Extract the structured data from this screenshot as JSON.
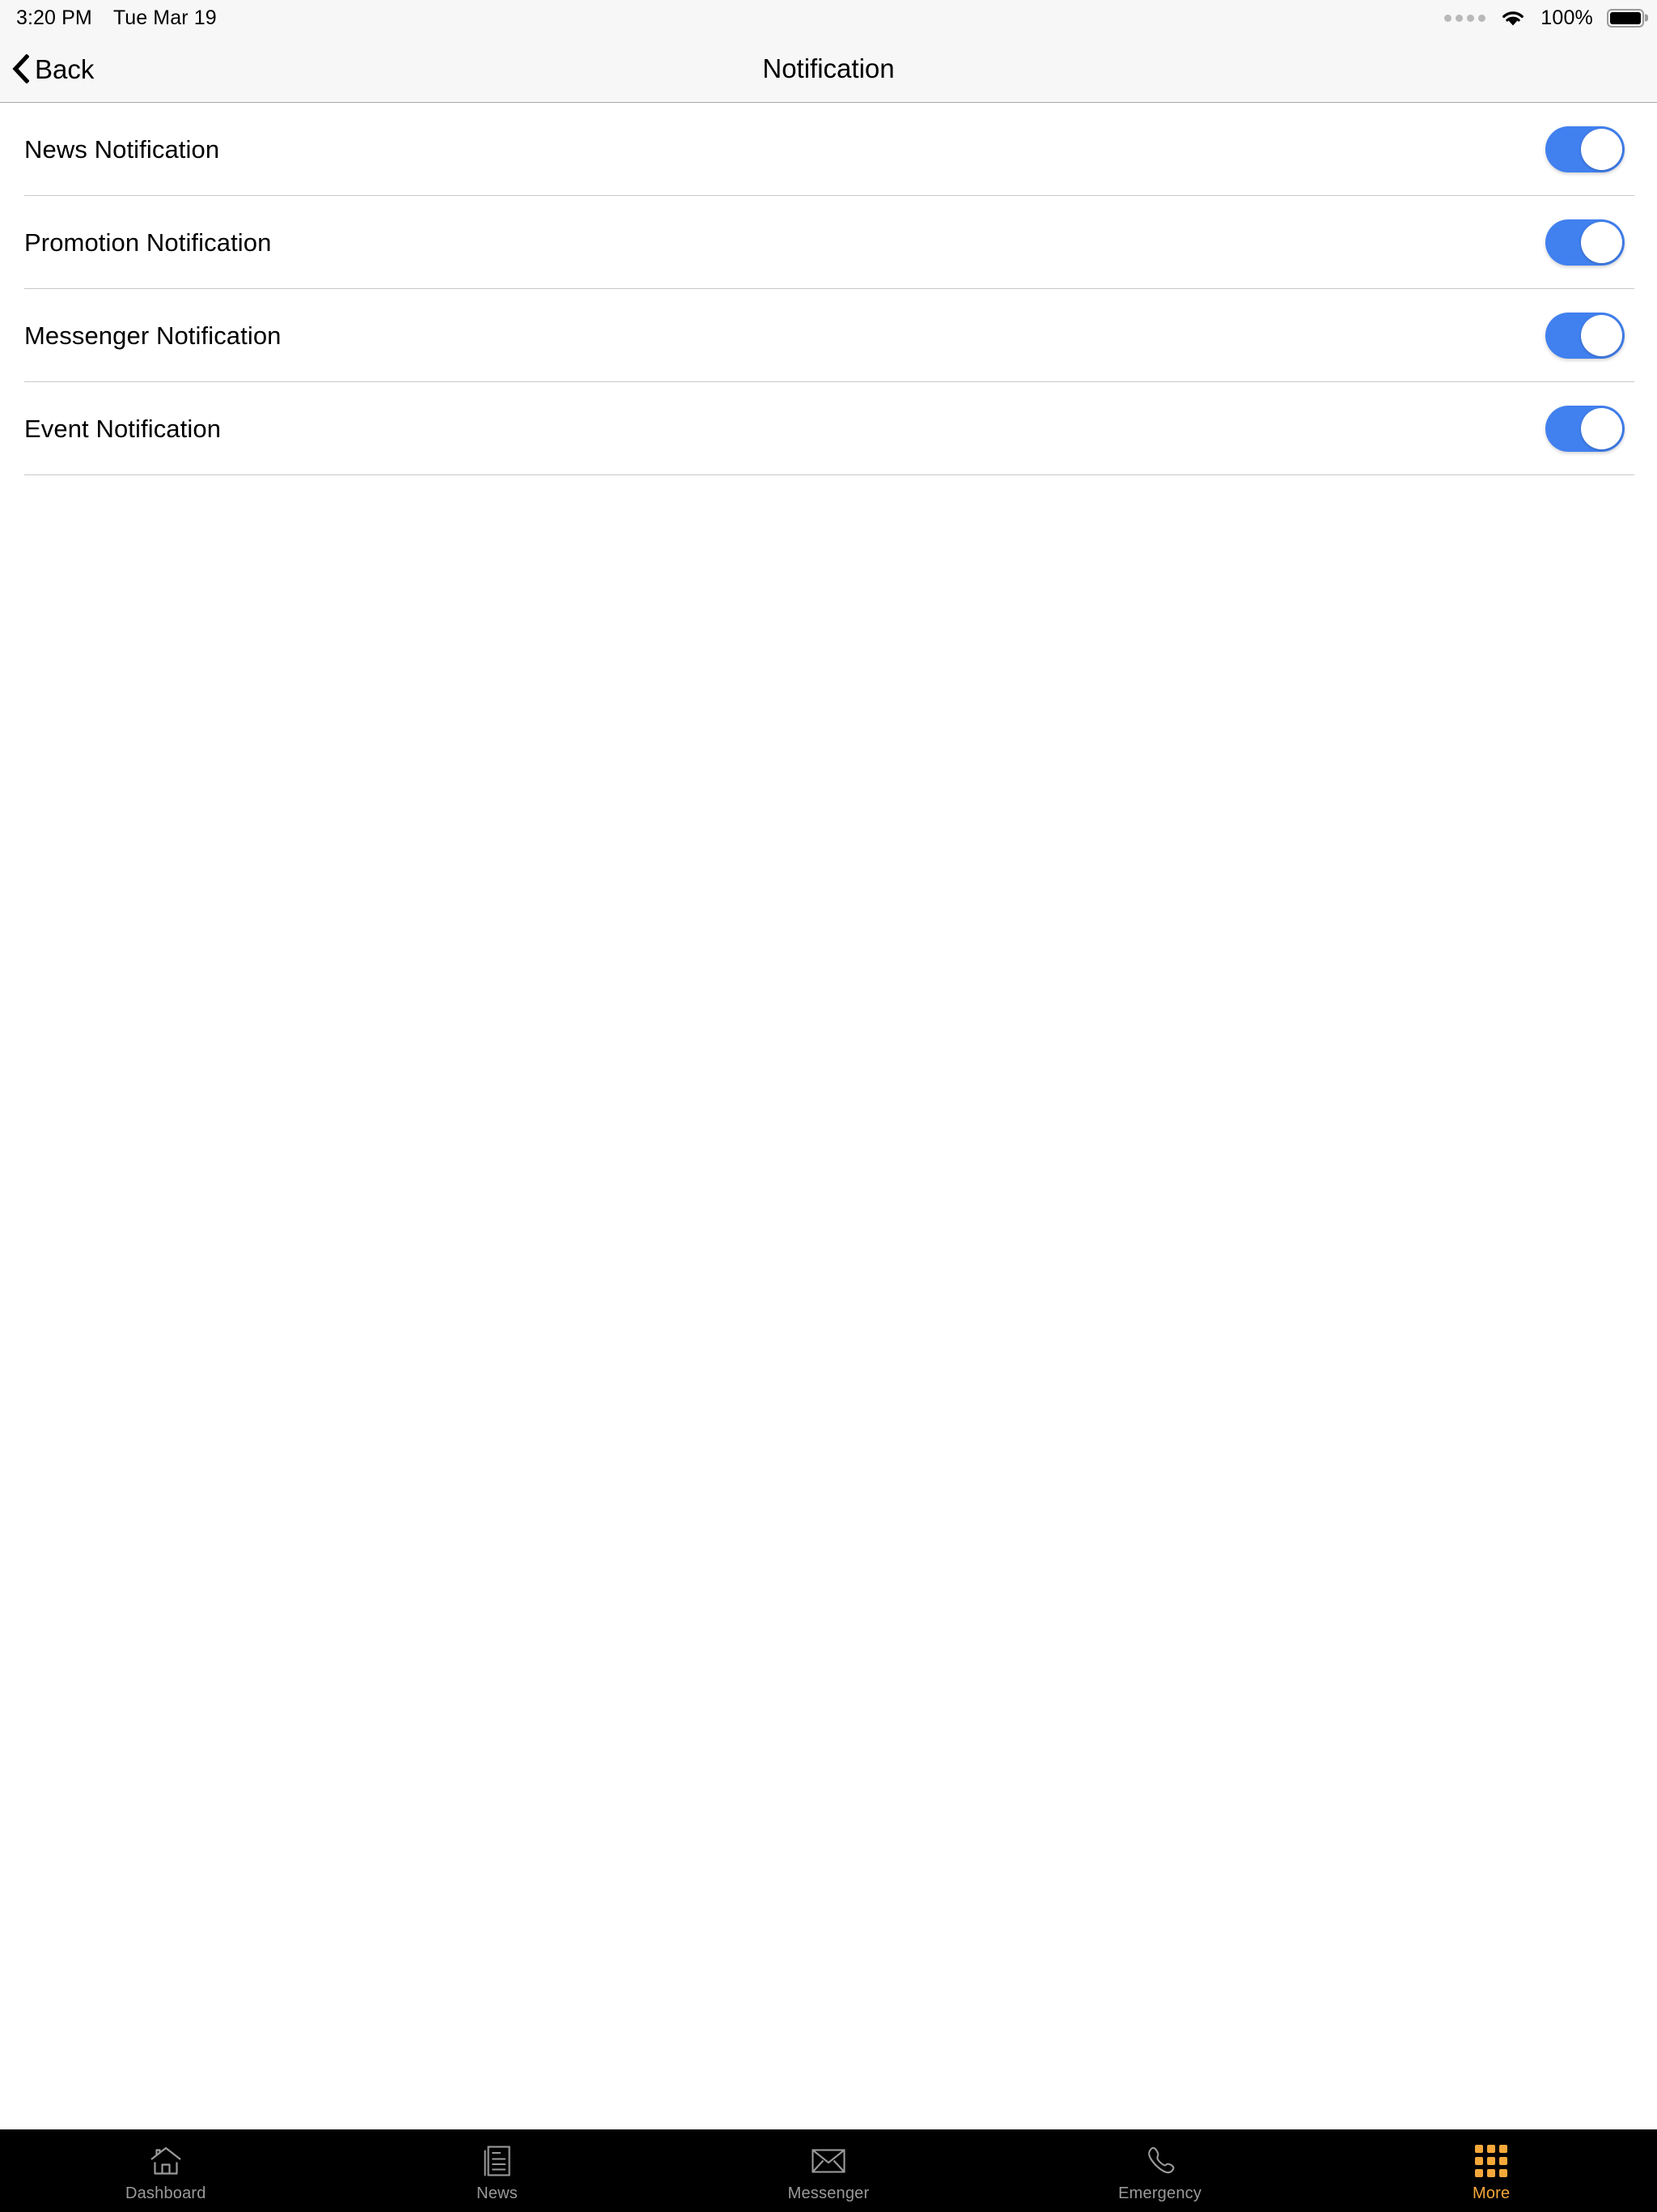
{
  "status_bar": {
    "time": "3:20 PM",
    "date": "Tue Mar 19",
    "battery_percent": "100%",
    "signal_icon": "signal-dots-icon",
    "wifi_icon": "wifi-icon",
    "battery_icon": "battery-full-icon",
    "background_color": "#f7f7f7",
    "text_color": "#000000"
  },
  "nav_bar": {
    "back_label": "Back",
    "back_icon": "chevron-left-icon",
    "title": "Notification",
    "background_color": "#f7f7f7",
    "text_color": "#000000",
    "border_color": "#a8a8a8"
  },
  "settings": {
    "accent_on_color": "#4180ef",
    "separator_color": "#c8c8c8",
    "rows": [
      {
        "label": "News Notification",
        "state": "on"
      },
      {
        "label": "Promotion Notification",
        "state": "on"
      },
      {
        "label": "Messenger Notification",
        "state": "on"
      },
      {
        "label": "Event Notification",
        "state": "on"
      }
    ]
  },
  "tab_bar": {
    "background_color": "#000000",
    "inactive_color": "#9a9a9a",
    "active_color": "#f5a83a",
    "active_index": 4,
    "items": [
      {
        "label": "Dashboard",
        "icon": "home-icon",
        "active": false
      },
      {
        "label": "News",
        "icon": "newspaper-icon",
        "active": false
      },
      {
        "label": "Messenger",
        "icon": "envelope-icon",
        "active": false
      },
      {
        "label": "Emergency",
        "icon": "phone-icon",
        "active": false
      },
      {
        "label": "More",
        "icon": "grid-icon",
        "active": true
      }
    ]
  }
}
